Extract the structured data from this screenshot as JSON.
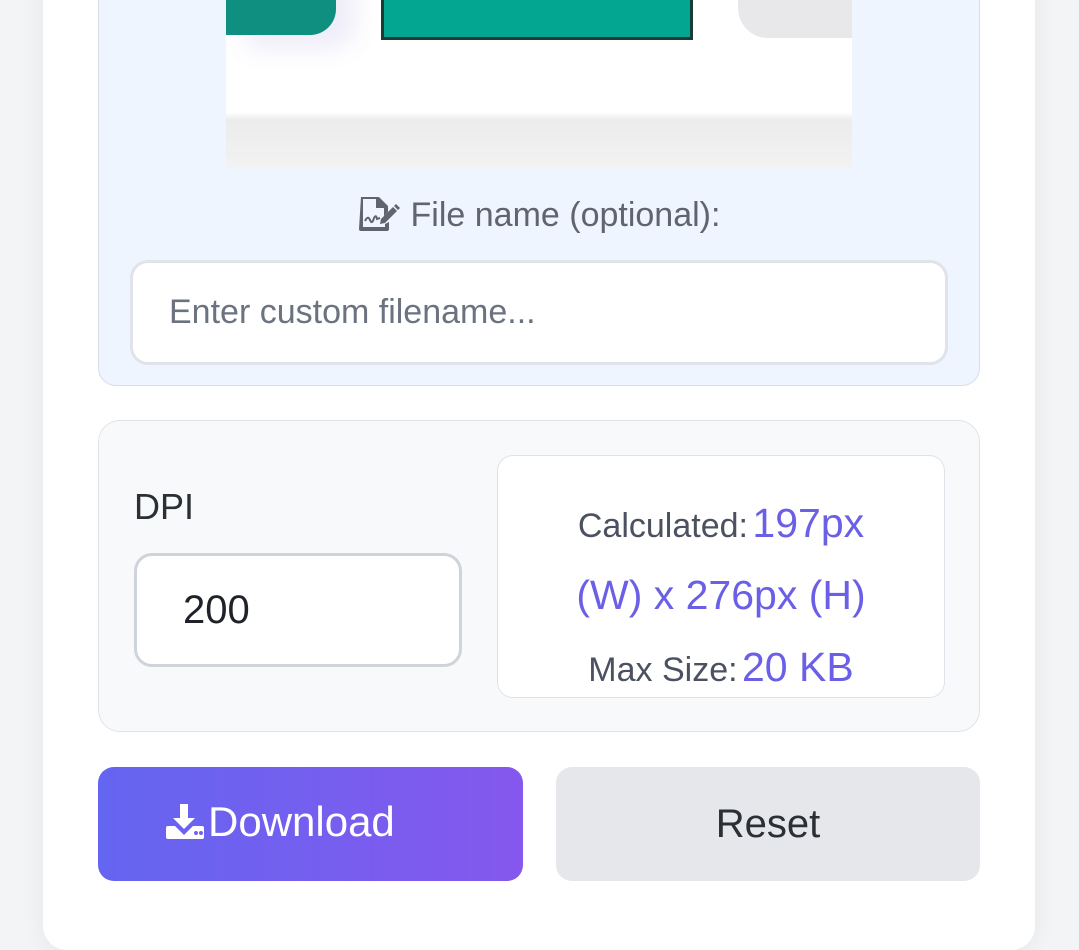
{
  "filename": {
    "label": "File name (optional):",
    "placeholder": "Enter custom filename...",
    "value": ""
  },
  "dpi": {
    "label": "DPI",
    "value": "200"
  },
  "calculated": {
    "label": "Calculated:",
    "dimensions_part1": "197px",
    "dimensions_part2": "(W) x 276px (H)",
    "max_size_label": "Max Size:",
    "max_size_value": "20 KB"
  },
  "buttons": {
    "download_label": "Download",
    "reset_label": "Reset"
  },
  "colors": {
    "accent": "#6a5fe6",
    "download_gradient_start": "#6465f0",
    "download_gradient_end": "#8558ee"
  }
}
